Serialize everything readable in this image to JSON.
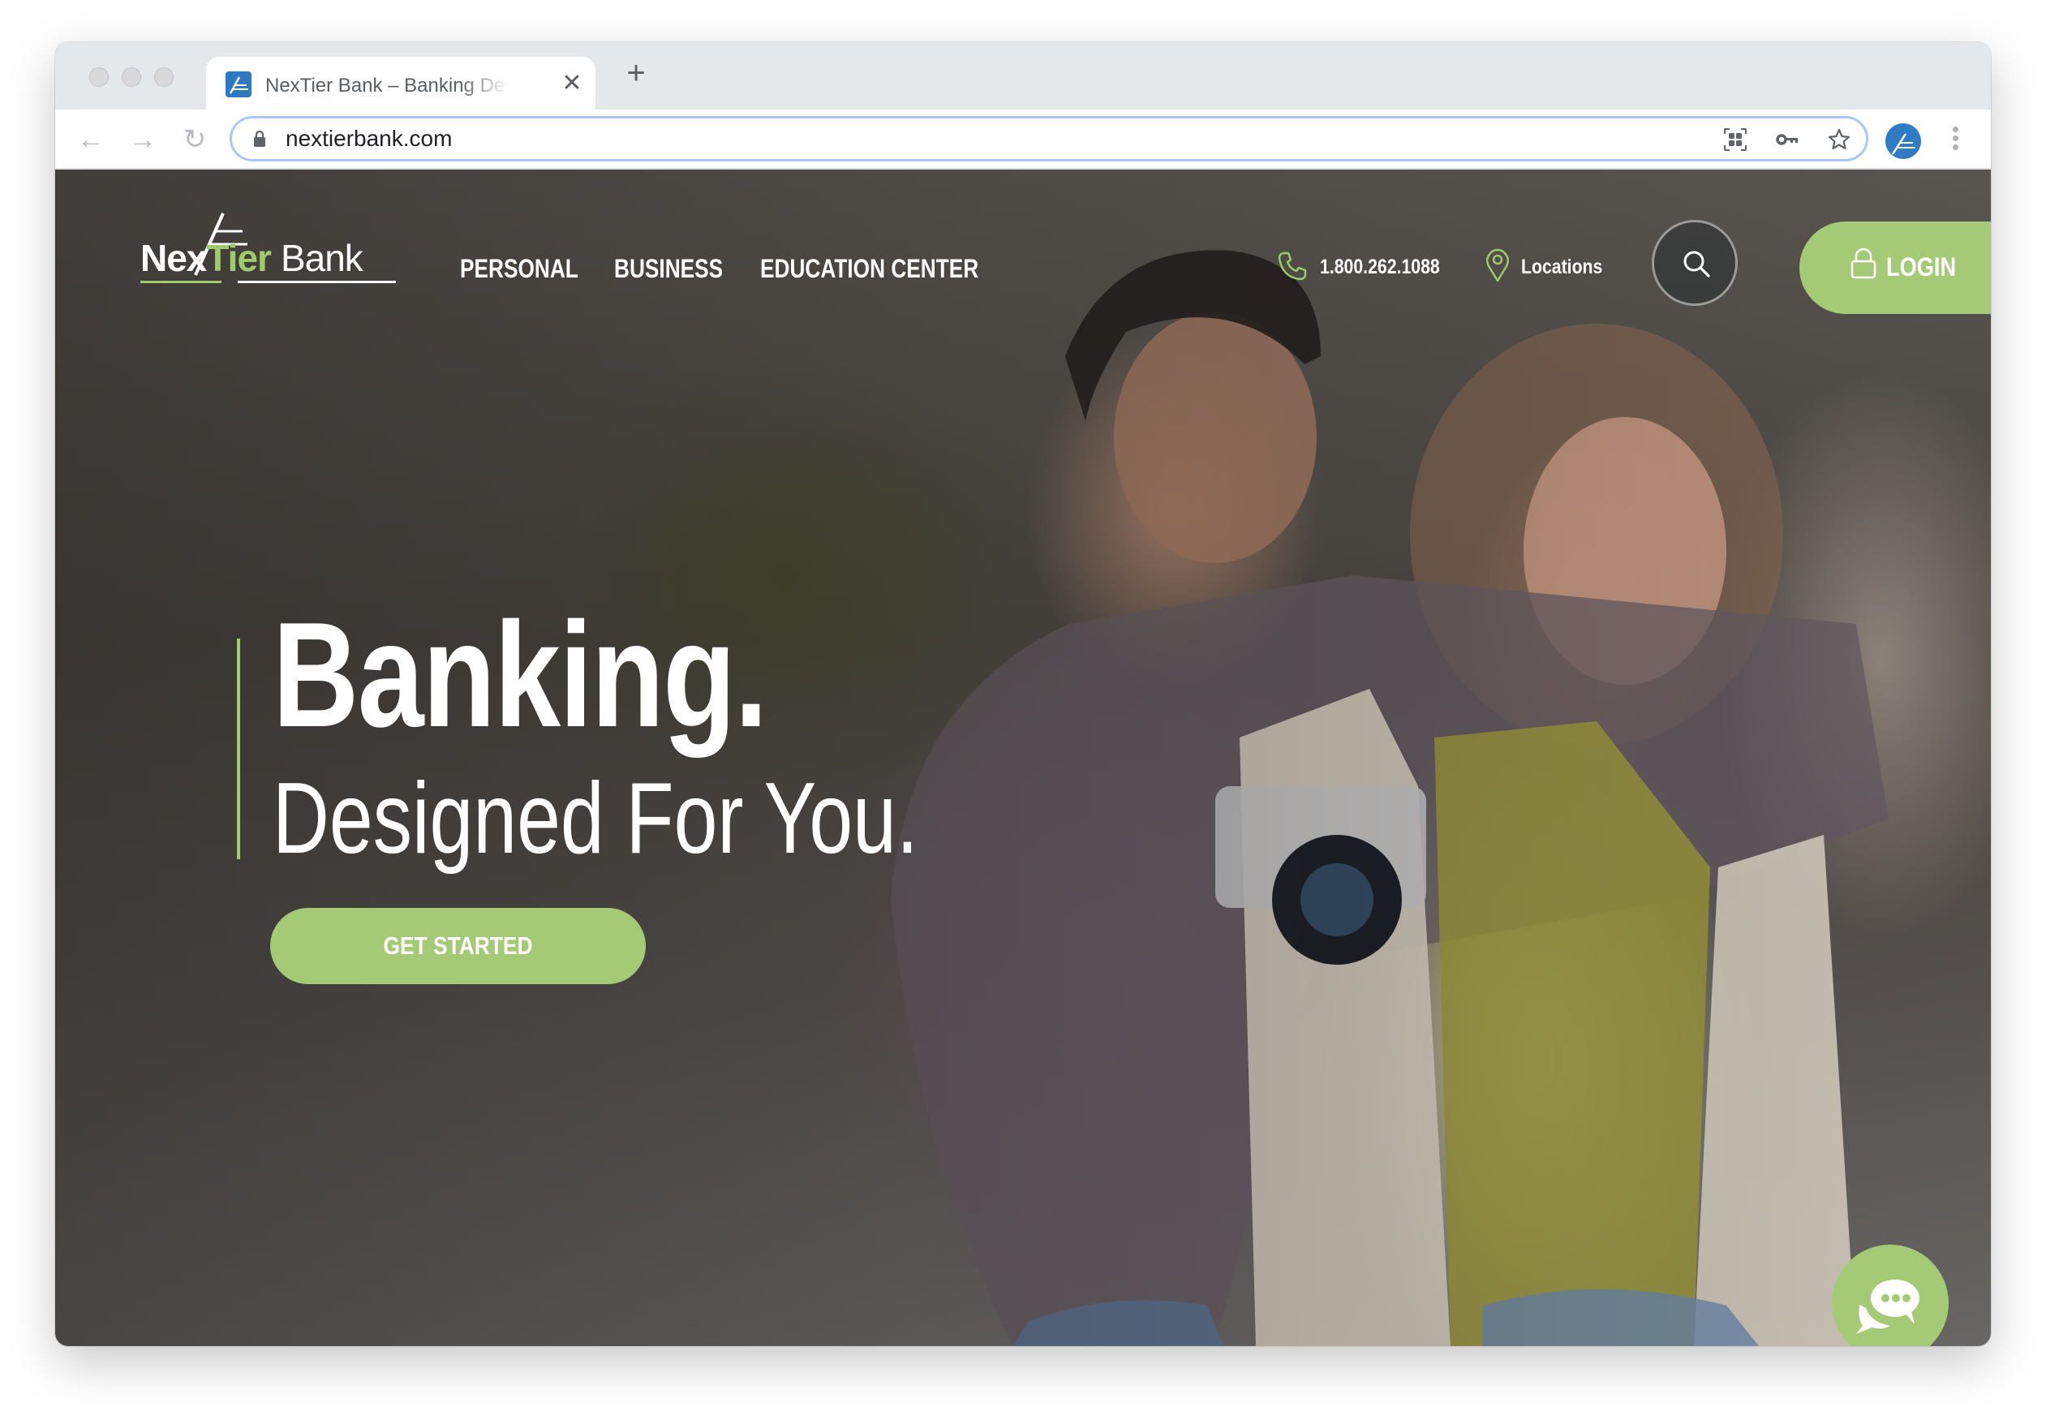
{
  "browser": {
    "tab": {
      "title": "NexTier Bank – Banking Designed For You",
      "close_glyph": "✕",
      "favicon": "nextier-favicon"
    },
    "new_tab_glyph": "+",
    "nav": {
      "back_glyph": "←",
      "forward_glyph": "→",
      "reload_glyph": "↻"
    },
    "address_bar": {
      "url": "nextierbank.com",
      "secure": true
    },
    "toolbar_icons": [
      "qr-code-icon",
      "key-icon",
      "bookmark-star-icon",
      "profile-avatar",
      "menu-dots-icon"
    ]
  },
  "site": {
    "logo": {
      "part1": "Nex",
      "part2": "Tier",
      "part3": "Bank"
    },
    "nav": {
      "items": [
        {
          "label": "PERSONAL"
        },
        {
          "label": "BUSINESS"
        },
        {
          "label": "EDUCATION CENTER"
        }
      ]
    },
    "utility": {
      "phone": "1.800.262.1088",
      "locations": "Locations"
    },
    "login": {
      "label": "LOGIN"
    },
    "hero": {
      "headline": "Banking.",
      "subheadline": "Designed For You.",
      "cta": "GET STARTED"
    },
    "chat": {
      "icon": "chat-bubbles-icon"
    }
  },
  "colors": {
    "brand_green": "#a5ca75",
    "logo_green": "#9fcc6b",
    "favicon_blue": "#2e77c2",
    "omnibox_focus": "#a8c7fa"
  }
}
